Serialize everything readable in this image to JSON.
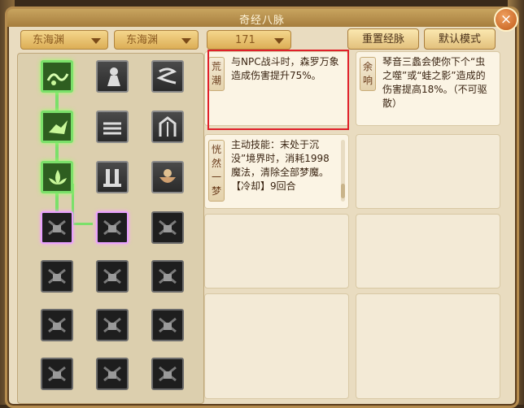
{
  "window": {
    "title": "奇经八脉",
    "close_label": "×"
  },
  "toolbar": {
    "dropdowns": [
      "东海渊",
      "东海渊",
      "171"
    ],
    "reset_label": "重置经脉",
    "default_label": "默认模式"
  },
  "cards": [
    {
      "tag": "荒潮",
      "text": "与NPC战斗时，森罗万象造成伤害提升75%。"
    },
    {
      "tag": "余响",
      "text": "琴音三蠡会使你下个“虫之噬”或“蛙之影”造成的伤害提高18%。（不可驱散）"
    },
    {
      "tag": "恍然一梦",
      "text": "主动技能：末处于沉没”境界时，消耗1998魔法，清除全部梦魔。\n【冷却】9回合"
    }
  ],
  "colors": {
    "active_node": "#7be06a",
    "highlight": "#e0202a"
  }
}
